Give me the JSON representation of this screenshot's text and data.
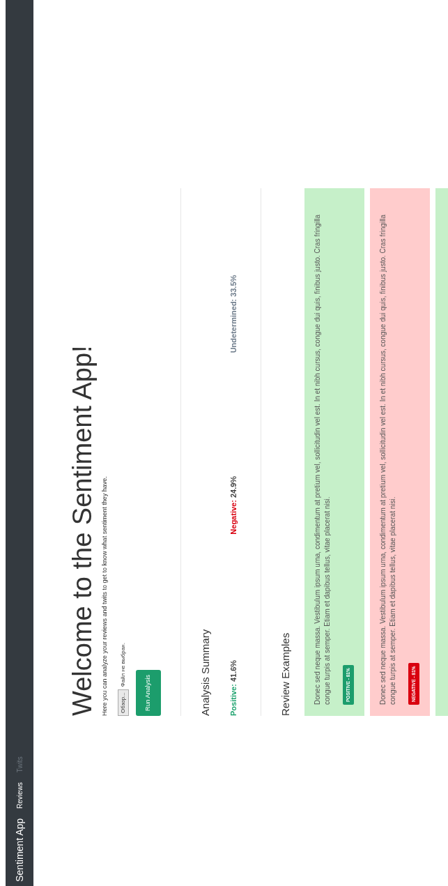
{
  "navbar": {
    "brand": "Sentiment App",
    "links": [
      {
        "label": "Reviews",
        "selected": true
      },
      {
        "label": "Twits",
        "selected": false
      }
    ]
  },
  "header": {
    "title": "Welcome to the Sentiment App!",
    "subtitle": "Here you can analyze your reviews and twits to get to know what sentiment they have.",
    "file_input": {
      "button": "Обзор...",
      "status": "Файл не выбран."
    },
    "run_button": "Run Analysis"
  },
  "summary": {
    "title": "Analysis Summary",
    "stats": [
      {
        "kind": "positive",
        "label": "Positive:",
        "value": "41.6%"
      },
      {
        "kind": "negative",
        "label": "Negative:",
        "value": "24.9%"
      },
      {
        "kind": "undetermined",
        "label": "Undetermined:",
        "value": "33.5%"
      }
    ]
  },
  "reviews": {
    "title": "Review Examples",
    "items": [
      {
        "kind": "positive",
        "text": "Donec sed neque massa. Vestibulum ipsum urna, condimentum at pretium vel, sollicitudin vel est. In et nibh cursus, congue dui quis, finibus justo. Cras fringilla congue turpis at semper. Etiam et dapibus tellus, vitae placerat nisi.",
        "badge": "POSITIVE - 81%"
      },
      {
        "kind": "negative",
        "text": "Donec sed neque massa. Vestibulum ipsum urna, condimentum at pretium vel, sollicitudin vel est. In et nibh cursus, congue dui quis, finibus justo. Cras fringilla congue turpis at semper. Etiam et dapibus tellus, vitae placerat nisi.",
        "badge": "NEGATIVE - 81%"
      },
      {
        "kind": "positive"
      }
    ]
  }
}
